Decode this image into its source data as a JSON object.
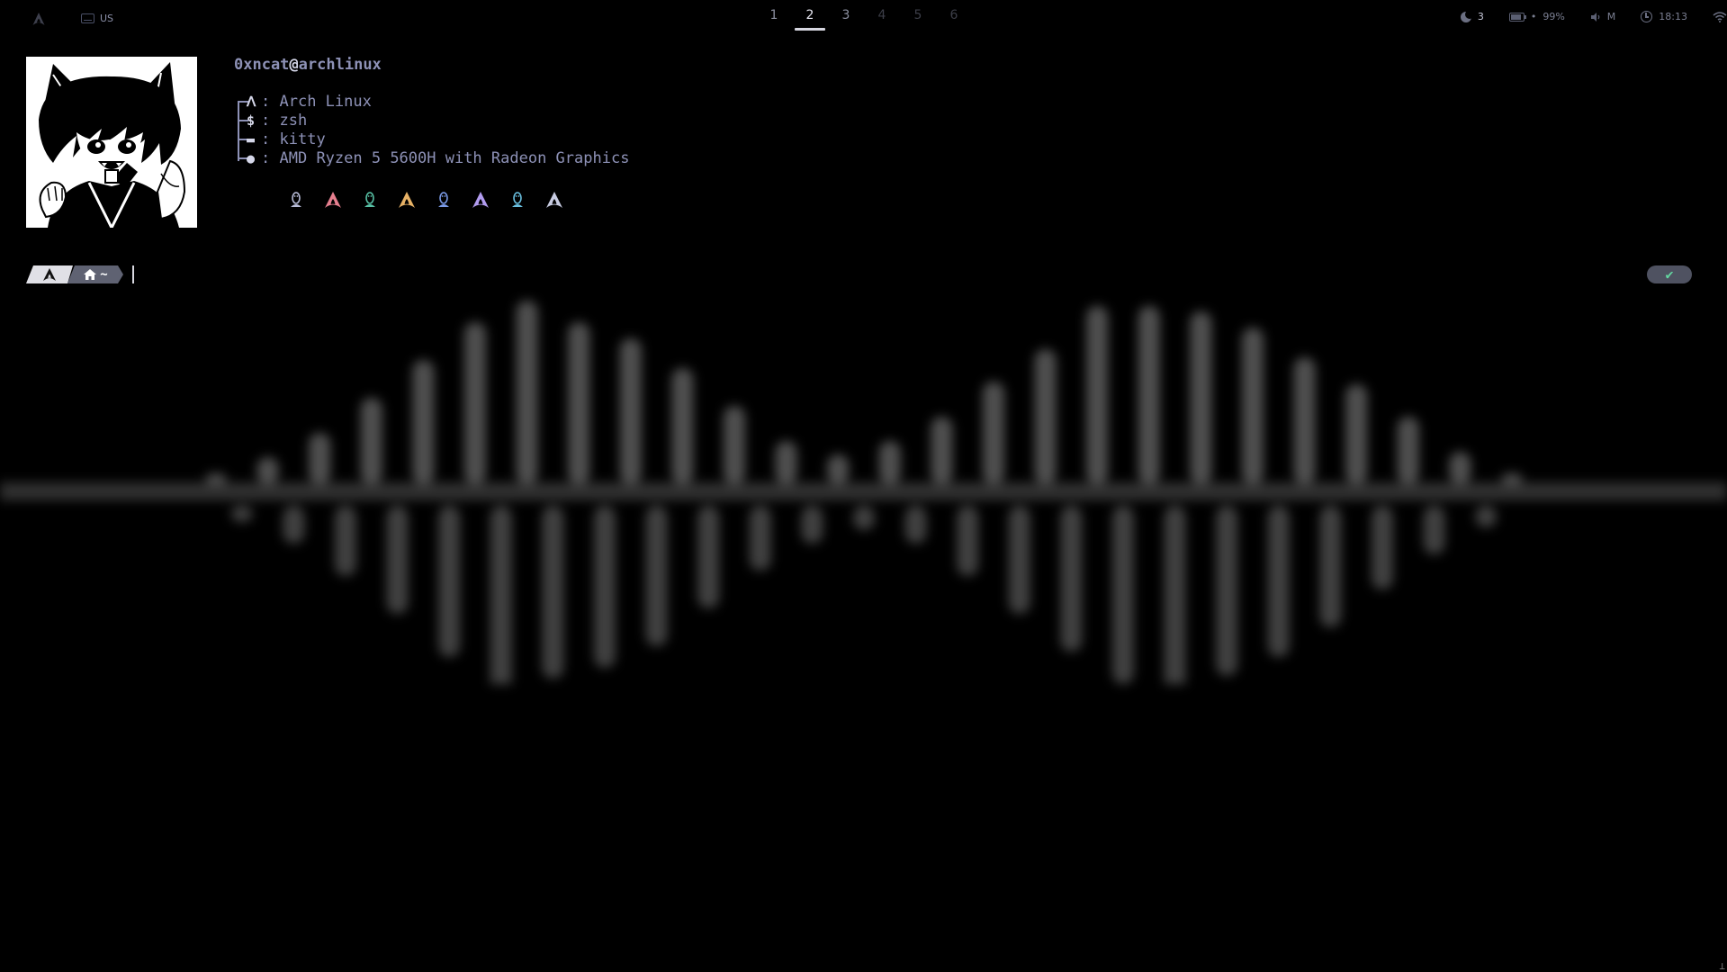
{
  "topbar": {
    "arch_icon": "arch-logo-icon",
    "keyboard_layout": "US",
    "workspaces": [
      {
        "label": "1",
        "state": "occupied"
      },
      {
        "label": "2",
        "state": "active"
      },
      {
        "label": "3",
        "state": "occupied"
      },
      {
        "label": "4",
        "state": "empty"
      },
      {
        "label": "5",
        "state": "empty"
      },
      {
        "label": "6",
        "state": "empty"
      }
    ],
    "updates": "3",
    "battery": "99%",
    "volume": "M",
    "clock": "18:13"
  },
  "fetch": {
    "user": "0xncat",
    "at": "@",
    "host": "archlinux",
    "rows": [
      {
        "icon": "arch-icon",
        "label": "Arch Linux"
      },
      {
        "icon": "shell-icon",
        "label": "zsh"
      },
      {
        "icon": "terminal-icon",
        "label": "kitty"
      },
      {
        "icon": "cpu-icon",
        "label": "AMD Ryzen 5 5600H with Radeon Graphics"
      }
    ],
    "separator": ":",
    "color_icons": [
      {
        "type": "tux",
        "color": "#b8bcd8"
      },
      {
        "type": "arch",
        "color": "#e67f8f"
      },
      {
        "type": "tux",
        "color": "#58c2a6"
      },
      {
        "type": "arch",
        "color": "#e8b266"
      },
      {
        "type": "tux",
        "color": "#7b9be8"
      },
      {
        "type": "arch",
        "color": "#b29cf0"
      },
      {
        "type": "tux",
        "color": "#6ac0e0"
      },
      {
        "type": "arch",
        "color": "#c8cce2"
      }
    ]
  },
  "prompt": {
    "home": "~",
    "status_check": "✔"
  },
  "visualizer": {
    "color": "#6a6a6a",
    "bars_top": [
      4,
      10,
      19,
      32,
      46,
      60,
      68,
      60,
      54,
      43,
      29,
      16,
      11,
      16,
      25,
      38,
      50,
      66,
      66,
      64,
      58,
      47,
      37,
      25,
      12,
      4
    ],
    "bars_bottom": [
      6,
      14,
      26,
      40,
      56,
      69,
      64,
      60,
      52,
      38,
      24,
      14,
      9,
      14,
      26,
      40,
      54,
      66,
      69,
      63,
      56,
      45,
      31,
      18,
      8,
      4
    ]
  }
}
